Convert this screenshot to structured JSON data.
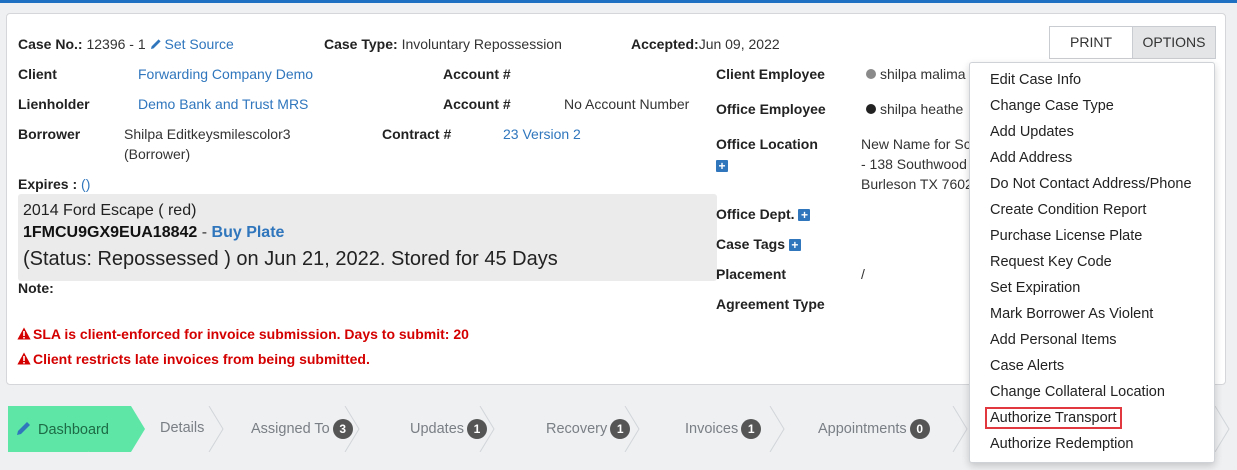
{
  "colors": {
    "accent": "#2f76bd",
    "alert": "#d40000",
    "active_tab": "#5ee6a6",
    "highlight_border": "#e0383e"
  },
  "case": {
    "case_no_label": "Case No.:",
    "case_no_value": "12396 - 1",
    "set_source": "Set Source",
    "case_type_label": "Case Type:",
    "case_type_value": "Involuntary Repossession",
    "accepted_label": "Accepted:",
    "accepted_value": "Jun 09, 2022"
  },
  "fields": {
    "client_label": "Client",
    "client_value": "Forwarding Company Demo",
    "lienholder_label": "Lienholder",
    "lienholder_value": "Demo Bank and Trust MRS",
    "borrower_label": "Borrower",
    "borrower_line1": "Shilpa Editkeysmilescolor3",
    "borrower_line2": "(Borrower)",
    "account1_label": "Account #",
    "account2_label": "Account #",
    "account2_value": "No Account Number",
    "contract_label": "Contract #",
    "contract_value": "23 Version 2",
    "expires_label": "Expires :",
    "expires_value": "()",
    "note_label": "Note:",
    "client_employee_label": "Client Employee",
    "client_employee_value": "shilpa malima",
    "office_employee_label": "Office Employee",
    "office_employee_value": "shilpa heathe",
    "office_location_label": "Office Location",
    "office_location_line1": "New Name for Sc",
    "office_location_line2": "- 138 Southwood",
    "office_location_line3": "Burleson TX 7602",
    "office_dept_label": "Office Dept.",
    "case_tags_label": "Case Tags",
    "placement_label": "Placement",
    "placement_value": "/",
    "agreement_type_label": "Agreement Type"
  },
  "vehicle": {
    "description": "2014 Ford Escape ( red)",
    "vin": "1FMCU9GX9EUA18842",
    "separator": " - ",
    "buy_plate": "Buy Plate",
    "status": "(Status: Repossessed ) on Jun 21, 2022. Stored for 45 Days"
  },
  "alerts": [
    "SLA is client-enforced for invoice submission. Days to submit: 20",
    "Client restricts late invoices from being submitted."
  ],
  "buttons": {
    "print": "PRINT",
    "options": "OPTIONS"
  },
  "options_menu": [
    "Edit Case Info",
    "Change Case Type",
    "Add Updates",
    "Add Address",
    "Do Not Contact Address/Phone",
    "Create Condition Report",
    "Purchase License Plate",
    "Request Key Code",
    "Set Expiration",
    "Mark Borrower As Violent",
    "Add Personal Items",
    "Case Alerts",
    "Change Collateral Location",
    "Authorize Transport",
    "Authorize Redemption"
  ],
  "tabs": [
    {
      "label": "Dashboard",
      "icon": "pencil-icon"
    },
    {
      "label": "Details"
    },
    {
      "label": "Assigned To",
      "count": "3"
    },
    {
      "label": "Updates",
      "count": "1"
    },
    {
      "label": "Recovery",
      "count": "1"
    },
    {
      "label": "Invoices",
      "count": "1"
    },
    {
      "label": "Appointments",
      "count": "0"
    }
  ]
}
